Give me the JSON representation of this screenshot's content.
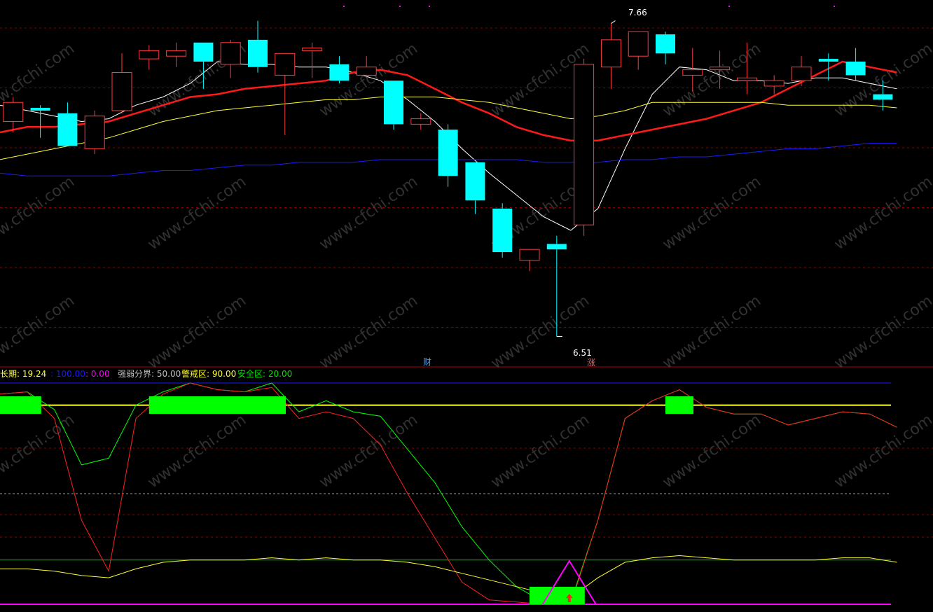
{
  "colors": {
    "up": "#ff3c3c",
    "down": "#00ffff",
    "ma_short": "#ffffff",
    "ma_mid": "#ff1a1a",
    "ma_long": "#ffff33",
    "ma_vlong": "#1a1aff",
    "grid": "#8a0000",
    "separator": "#b00000",
    "wm": "#5a5a5a"
  },
  "watermark": "www.cfchi.com",
  "main_panel": {
    "max_label": "7.66",
    "min_label": "6.51",
    "marker_cai": "财",
    "marker_zhang": "涨"
  },
  "indicator_panel": {
    "legend": [
      {
        "text": "长期: 19.24",
        "color": "#ffff33"
      },
      {
        "text": ": 100.00",
        "color": "#1a1aff"
      },
      {
        "text": ": 0.00",
        "color": "#ff00ff"
      },
      {
        "text": "强弱分界: 50.00",
        "color": "#c0c0c0"
      },
      {
        "text": "警戒区: 90.00",
        "color": "#ffff33"
      },
      {
        "text": "安全区: 20.00",
        "color": "#00e000"
      }
    ]
  },
  "chart_data": [
    {
      "type": "candlestick",
      "y_range": [
        6.46,
        7.7
      ],
      "candles": [
        {
          "o": 7.32,
          "h": 7.35,
          "c": 7.28,
          "l": 7.26
        },
        {
          "o": 7.3,
          "h": 7.39,
          "c": 7.37,
          "l": 7.26
        },
        {
          "o": 7.35,
          "h": 7.36,
          "c": 7.34,
          "l": 7.24
        },
        {
          "o": 7.33,
          "h": 7.37,
          "c": 7.21,
          "l": 7.21
        },
        {
          "o": 7.2,
          "h": 7.34,
          "c": 7.32,
          "l": 7.18
        },
        {
          "o": 7.34,
          "h": 7.55,
          "c": 7.48,
          "l": 7.33
        },
        {
          "o": 7.53,
          "h": 7.58,
          "c": 7.56,
          "l": 7.49
        },
        {
          "o": 7.54,
          "h": 7.59,
          "c": 7.56,
          "l": 7.5
        },
        {
          "o": 7.59,
          "h": 7.59,
          "c": 7.52,
          "l": 7.42
        },
        {
          "o": 7.51,
          "h": 7.6,
          "c": 7.59,
          "l": 7.46
        },
        {
          "o": 7.6,
          "h": 7.67,
          "c": 7.5,
          "l": 7.48
        },
        {
          "o": 7.47,
          "h": 7.54,
          "c": 7.55,
          "l": 7.25
        },
        {
          "o": 7.56,
          "h": 7.59,
          "c": 7.57,
          "l": 7.46
        },
        {
          "o": 7.51,
          "h": 7.54,
          "c": 7.45,
          "l": 7.44
        },
        {
          "o": 7.47,
          "h": 7.54,
          "c": 7.5,
          "l": 7.46
        },
        {
          "o": 7.45,
          "h": 7.45,
          "c": 7.29,
          "l": 7.27
        },
        {
          "o": 7.29,
          "h": 7.33,
          "c": 7.31,
          "l": 7.27
        },
        {
          "o": 7.27,
          "h": 7.29,
          "c": 7.1,
          "l": 7.06
        },
        {
          "o": 7.15,
          "h": 7.15,
          "c": 7.01,
          "l": 6.96
        },
        {
          "o": 6.98,
          "h": 7.0,
          "c": 6.82,
          "l": 6.8
        },
        {
          "o": 6.79,
          "h": 6.8,
          "c": 6.83,
          "l": 6.75
        },
        {
          "o": 6.85,
          "h": 6.88,
          "c": 6.83,
          "l": 6.51
        },
        {
          "o": 6.92,
          "h": 7.53,
          "c": 7.51,
          "l": 6.88
        },
        {
          "o": 7.5,
          "h": 7.66,
          "c": 7.6,
          "l": 7.42
        },
        {
          "o": 7.54,
          "h": 7.63,
          "c": 7.63,
          "l": 7.49
        },
        {
          "o": 7.62,
          "h": 7.63,
          "c": 7.55,
          "l": 7.51
        },
        {
          "o": 7.47,
          "h": 7.57,
          "c": 7.49,
          "l": 7.41
        },
        {
          "o": 7.49,
          "h": 7.56,
          "c": 7.5,
          "l": 7.42
        },
        {
          "o": 7.45,
          "h": 7.59,
          "c": 7.46,
          "l": 7.4
        },
        {
          "o": 7.43,
          "h": 7.47,
          "c": 7.45,
          "l": 7.4
        },
        {
          "o": 7.45,
          "h": 7.54,
          "c": 7.5,
          "l": 7.43
        },
        {
          "o": 7.53,
          "h": 7.55,
          "c": 7.52,
          "l": 7.45
        },
        {
          "o": 7.52,
          "h": 7.57,
          "c": 7.47,
          "l": 7.45
        },
        {
          "o": 7.4,
          "h": 7.45,
          "c": 7.38,
          "l": 7.34
        }
      ],
      "series": [
        {
          "values": [
            7.36,
            7.34,
            7.32,
            7.3,
            7.31,
            7.36,
            7.39,
            7.44,
            7.52,
            7.51,
            7.51,
            7.5,
            7.5,
            7.48,
            7.45,
            7.38,
            7.3,
            7.2,
            7.11,
            7.03,
            6.95,
            6.9,
            6.98,
            7.2,
            7.4,
            7.5,
            7.49,
            7.45,
            7.45,
            7.44,
            7.46,
            7.46,
            7.44,
            7.42
          ]
        },
        {
          "values": [
            7.26,
            7.28,
            7.28,
            7.29,
            7.3,
            7.33,
            7.36,
            7.39,
            7.4,
            7.42,
            7.43,
            7.44,
            7.45,
            7.48,
            7.49,
            7.47,
            7.42,
            7.37,
            7.33,
            7.28,
            7.25,
            7.23,
            7.23,
            7.25,
            7.27,
            7.29,
            7.31,
            7.34,
            7.37,
            7.42,
            7.47,
            7.52,
            7.5,
            7.48
          ]
        },
        {
          "values": [
            7.16,
            7.18,
            7.2,
            7.22,
            7.24,
            7.27,
            7.3,
            7.32,
            7.34,
            7.35,
            7.36,
            7.37,
            7.38,
            7.38,
            7.39,
            7.39,
            7.39,
            7.38,
            7.37,
            7.35,
            7.33,
            7.31,
            7.32,
            7.34,
            7.37,
            7.37,
            7.37,
            7.37,
            7.37,
            7.36,
            7.36,
            7.36,
            7.36,
            7.35
          ]
        },
        {
          "values": [
            7.11,
            7.1,
            7.1,
            7.1,
            7.1,
            7.11,
            7.12,
            7.12,
            7.13,
            7.14,
            7.14,
            7.15,
            7.15,
            7.15,
            7.16,
            7.16,
            7.16,
            7.16,
            7.16,
            7.16,
            7.15,
            7.15,
            7.15,
            7.16,
            7.16,
            7.17,
            7.17,
            7.18,
            7.19,
            7.2,
            7.2,
            7.21,
            7.22,
            7.22
          ]
        }
      ]
    },
    {
      "type": "line",
      "y_range": [
        0,
        100
      ],
      "series": [
        {
          "values": [
            95,
            96,
            88,
            63,
            66,
            90,
            96,
            100,
            97,
            96,
            100,
            87,
            92,
            87,
            85,
            70,
            55,
            35,
            20,
            8,
            1,
            1,
            38,
            84,
            92,
            97,
            89,
            86,
            86,
            81,
            84,
            87,
            86,
            80
          ]
        },
        {
          "values": [
            95,
            96,
            84,
            38,
            15,
            84,
            95,
            100,
            97,
            96,
            98,
            84,
            87,
            84,
            72,
            50,
            30,
            10,
            2,
            1,
            0,
            0,
            38,
            84,
            92,
            97,
            89,
            86,
            86,
            81,
            84,
            87,
            86,
            80
          ]
        },
        {
          "values": [
            16,
            16,
            15,
            13,
            12,
            16,
            19,
            20,
            20,
            20,
            21,
            20,
            21,
            20,
            20,
            19,
            17,
            14,
            11,
            8,
            5,
            3,
            12,
            19,
            21,
            22,
            21,
            20,
            20,
            20,
            20,
            21,
            21,
            19
          ]
        }
      ]
    }
  ]
}
